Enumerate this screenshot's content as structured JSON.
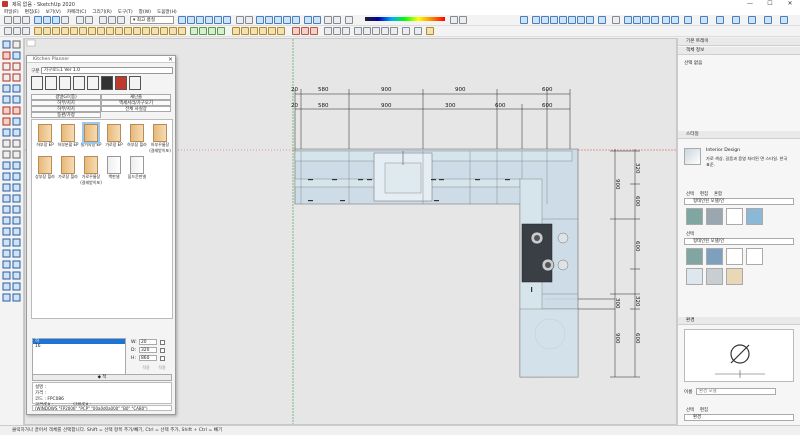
{
  "window": {
    "title": "제목 없음 - SketchUp 2020",
    "minimize": "—",
    "maximize": "☐",
    "close": "✕"
  },
  "menu": [
    "파일(F)",
    "편집(E)",
    "보기(V)",
    "카메라(C)",
    "그리기(R)",
    "도구(T)",
    "창(W)",
    "도움말(H)"
  ],
  "toolbar": {
    "style_select": "▾ 최고 품질"
  },
  "viewport": {
    "dims_top_row1": [
      "20",
      "580",
      "900",
      "900",
      "600"
    ],
    "dims_top_row2": [
      "20",
      "580",
      "900",
      "300",
      "600",
      "600"
    ],
    "dims_right_col1": [
      "320",
      "600",
      "600",
      "320",
      "600"
    ],
    "dims_right_col2": [
      "900",
      "300",
      "900"
    ]
  },
  "kitchen_planner": {
    "title": "Kitchen Planner",
    "version_label": "구분 :",
    "version_value": "가구로드1 Ver 1.0",
    "tabs_row1": [
      "걸낼GT(통)",
      "재단플"
    ],
    "tabs_row2": [
      "하부/지지",
      "액세서리/가구오기"
    ],
    "tabs_row3": [
      "하부/지지",
      "전체 사실장"
    ],
    "tabs_row4": [
      "동판/가정"
    ],
    "products": [
      "하부장 EP",
      "하부분할 EP",
      "설거지장 EP",
      "가로장 EP",
      "하부장 힐라",
      "하부꾸룸장(걸레받이포)",
      "상부장 힐라",
      "가로장 힐라",
      "가로꾸룸장(걸레받이포)",
      "백판넬",
      "옵드운판넬"
    ],
    "list": [
      "하",
      "16"
    ],
    "dim_labels": {
      "w": "W:",
      "d": "D:",
      "h": "H:"
    },
    "dims": {
      "w": "20",
      "d": "320",
      "h": "860"
    },
    "btn_small": [
      "적용",
      "적용"
    ],
    "btn_apply": "◆ 적",
    "info_lines": [
      "설명 :",
      "가격 :",
      "코드 : FPC086",
      "규격/EA :",
      "단위/EA :"
    ],
    "cmd": "(WINDOWS \"FP2006\" \"PCP\" \"00a0d0a000\" \"B0\" \"CAB0\")"
  },
  "tray": {
    "title": "기본 트레이",
    "sec_entity": "객체 정보",
    "entity_text": "선택 없음",
    "sec_styles": "스타일",
    "style_name": "Interior Design",
    "style_desc": "가로 색상, 길음과 음영 처리된 면 스타일. 한국 표준.",
    "style_tabs": [
      "선택",
      "편집",
      "혼합"
    ],
    "style_sel1": "형태인된 모델/인",
    "style_sel2": "형태인된 모델/인",
    "sec_scenes": "환경",
    "scene_name_label": "이름",
    "scene_name_placeholder": "환경 모델",
    "scene_tabs": [
      "선택",
      "편집"
    ],
    "scene_sel": "환경"
  },
  "status": "클릭하거나 끌어서 객체를 선택합니다. Shift = 선택 항목 추가/빼기, Ctrl = 선택 추가, Shift + Ctrl = 빼기",
  "colors": {
    "accent": "#1e73d8",
    "wood": "#e8b87a",
    "glass": "#b8d0de"
  }
}
